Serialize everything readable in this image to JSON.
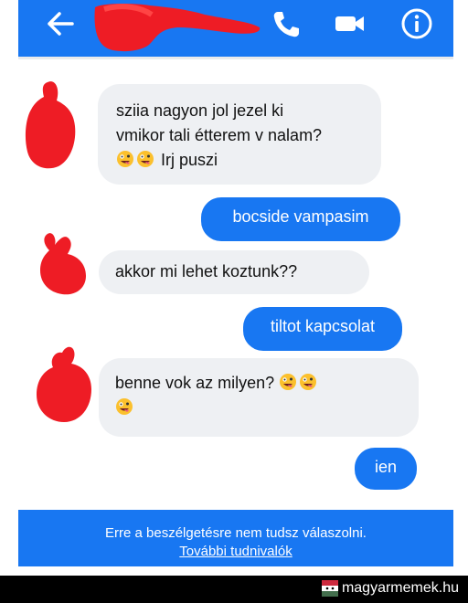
{
  "header": {
    "back_icon": "arrow-left-icon",
    "call_icon": "phone-icon",
    "video_icon": "video-camera-icon",
    "info_icon": "info-icon",
    "color": "#1877f2"
  },
  "messages": [
    {
      "side": "incoming",
      "lines": [
        "sziia nagyon jol jezel ki",
        "vmikor tali étterem v nalam?",
        "Irj puszi"
      ]
    },
    {
      "side": "outgoing",
      "text": "bocside vampasim"
    },
    {
      "side": "incoming",
      "text": "akkor mi lehet koztunk??"
    },
    {
      "side": "outgoing",
      "text": "tiltot kapcsolat"
    },
    {
      "side": "incoming",
      "lines": [
        "benne vok az milyen?",
        ""
      ]
    },
    {
      "side": "outgoing",
      "text": "ien"
    }
  ],
  "banner": {
    "text": "Erre a beszélgetésre nem tudsz válaszolni.",
    "link": "További tudnivalók"
  },
  "watermark": {
    "text": "magyarmemek.hu"
  }
}
